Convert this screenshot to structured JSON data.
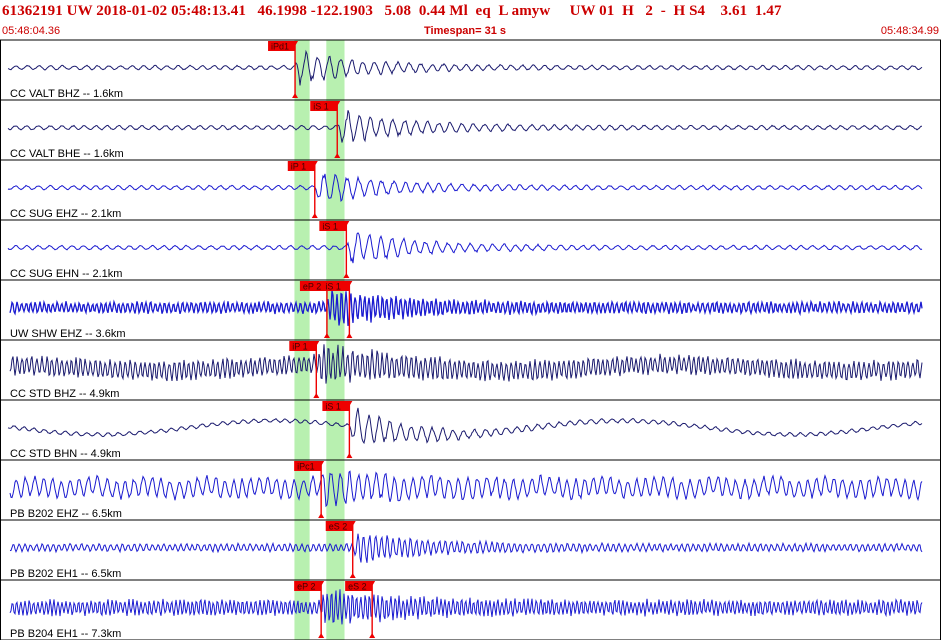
{
  "header": {
    "title": "61362191 UW 2018-01-02 05:48:13.41   46.1998 -122.1903   5.08  0.44 Ml  eq  L amyw     UW 01  H   2  -  H S4    3.61  1.47",
    "start_time": "05:48:04.36",
    "timespan": "Timespan=  31 s",
    "end_time": "05:48:34.99"
  },
  "colors": {
    "header_text": "#cc0000",
    "pick": "#ee0000",
    "window_green": "#b8f0b0",
    "trace_navy": "#1a1a6e",
    "trace_blue": "#1a1ad0"
  },
  "channels": [
    {
      "label": "CC VALT BHZ -- 1.6km",
      "color": "navy",
      "style": "lowamp",
      "picks": [
        {
          "label": "iPd1",
          "time": 9.72
        }
      ]
    },
    {
      "label": "CC VALT BHE -- 1.6km",
      "color": "navy",
      "style": "lowamp",
      "picks": [
        {
          "label": "iS 1",
          "time": 11.11
        }
      ]
    },
    {
      "label": "CC SUG EHZ -- 2.1km",
      "color": "blue",
      "style": "lowamp",
      "picks": [
        {
          "label": "iP 1",
          "time": 10.37
        }
      ]
    },
    {
      "label": "CC SUG EHN -- 2.1km",
      "color": "blue",
      "style": "lowamp",
      "picks": [
        {
          "label": "iS 1",
          "time": 11.41
        }
      ]
    },
    {
      "label": "UW SHW EHZ -- 3.6km",
      "color": "blue",
      "style": "band",
      "picks": [
        {
          "label": "eP 2",
          "time": 10.77
        },
        {
          "label": "iS 1",
          "time": 11.51
        }
      ]
    },
    {
      "label": "CC STD BHZ -- 4.9km",
      "color": "navy",
      "style": "noisy",
      "picks": [
        {
          "label": "iP 1",
          "time": 10.42
        }
      ]
    },
    {
      "label": "CC STD BHN -- 4.9km",
      "color": "navy",
      "style": "swell",
      "picks": [
        {
          "label": "iS 1",
          "time": 11.51
        }
      ]
    },
    {
      "label": "PB B202 EHZ -- 6.5km",
      "color": "blue",
      "style": "wavy",
      "picks": [
        {
          "label": "iPc1",
          "time": 10.58
        }
      ]
    },
    {
      "label": "PB B202 EH1 -- 6.5km",
      "color": "blue",
      "style": "medium",
      "picks": [
        {
          "label": "eS 2",
          "time": 11.62
        }
      ]
    },
    {
      "label": "PB B204 EH1 -- 7.3km",
      "color": "blue",
      "style": "dense",
      "picks": [
        {
          "label": "eP 2",
          "time": 10.58
        },
        {
          "label": "eS 2",
          "time": 12.26
        }
      ]
    }
  ]
}
